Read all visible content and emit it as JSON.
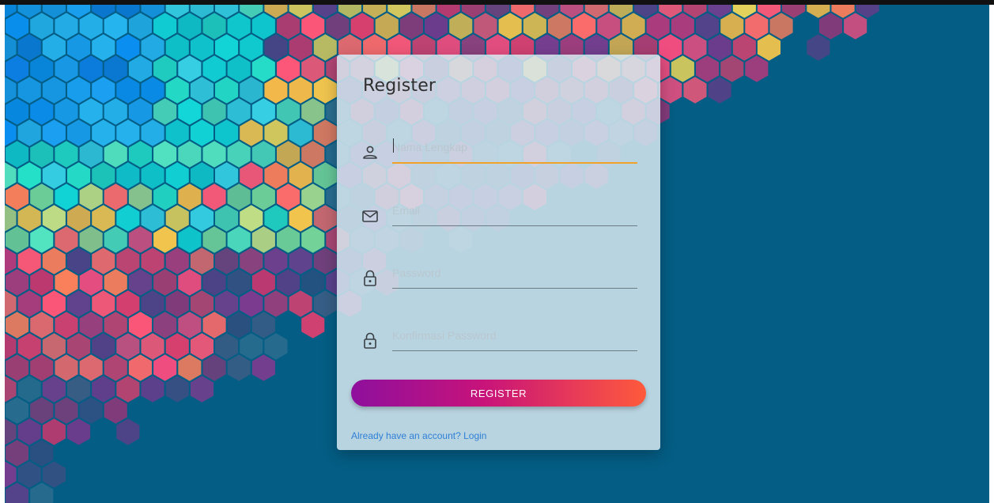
{
  "form": {
    "title": "Register",
    "fields": [
      {
        "icon": "user-icon",
        "placeholder": "Nama Lengkap",
        "value": ""
      },
      {
        "icon": "mail-icon",
        "placeholder": "Email",
        "value": ""
      },
      {
        "icon": "lock-icon",
        "placeholder": "Password",
        "value": ""
      },
      {
        "icon": "lock-icon",
        "placeholder": "Konfirmasi Password",
        "value": ""
      }
    ],
    "submit_label": "REGISTER",
    "login_link_text": "Already have an account? Login"
  },
  "colors": {
    "page_background": "#045d84",
    "card_background": "#d7e8f0",
    "focus_underline": "#f0a22a",
    "button_gradient_start": "#8e0f9d",
    "button_gradient_end": "#ff5a3c",
    "link": "#2f7fd6"
  }
}
